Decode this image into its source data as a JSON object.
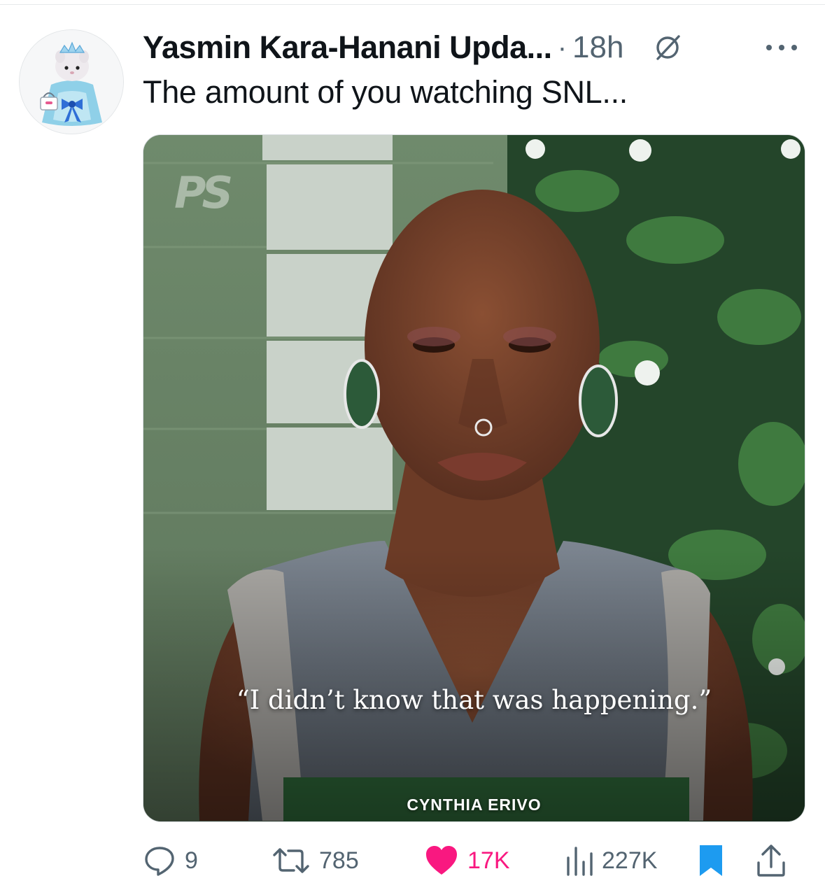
{
  "tweet": {
    "author_name": "Yasmin Kara-Hanani Upda...",
    "separator": "·",
    "time": "18h",
    "text": "The amount of you watching SNL...",
    "avatar_icon": "doll-avatar-icon",
    "grok_icon": "grok-icon",
    "more_icon": "more-icon"
  },
  "media": {
    "watermark": "PS",
    "quote": "“I didn’t know that was happening.”",
    "caption": "CYNTHIA ERIVO"
  },
  "actions": {
    "reply_count": "9",
    "retweet_count": "785",
    "like_count": "17K",
    "view_count": "227K",
    "bookmark_icon": "bookmark-icon",
    "share_icon": "share-icon"
  },
  "colors": {
    "text": "#0f1419",
    "secondary": "#536471",
    "like": "#f91880",
    "bookmark": "#1d9bf0"
  }
}
